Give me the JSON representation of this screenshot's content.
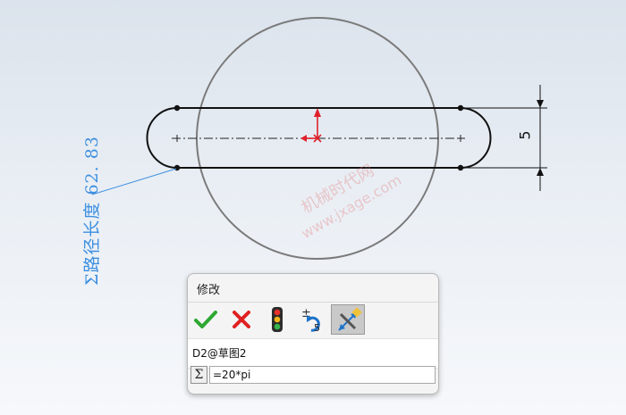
{
  "sketch": {
    "dimension_value": "5",
    "path_length_label": "Σ路径长度  62. 83"
  },
  "watermark": {
    "line1": "机械时代网",
    "line2": "www.jxage.com"
  },
  "modify_dialog": {
    "title": "修改",
    "toolbar": {
      "ok": "check-icon",
      "cancel": "cross-icon",
      "rebuild": "traffic-light-icon",
      "reverse": "reverse-dimension-icon",
      "mark_for_drawing": "mark-dimension-icon"
    },
    "dimension_name": "D2@草图2",
    "sigma_symbol": "Σ",
    "value": "=20*pi"
  },
  "colors": {
    "callout": "#3d8fe0",
    "origin": "#e0202a",
    "ok": "#2ea832",
    "cancel": "#e02020"
  }
}
